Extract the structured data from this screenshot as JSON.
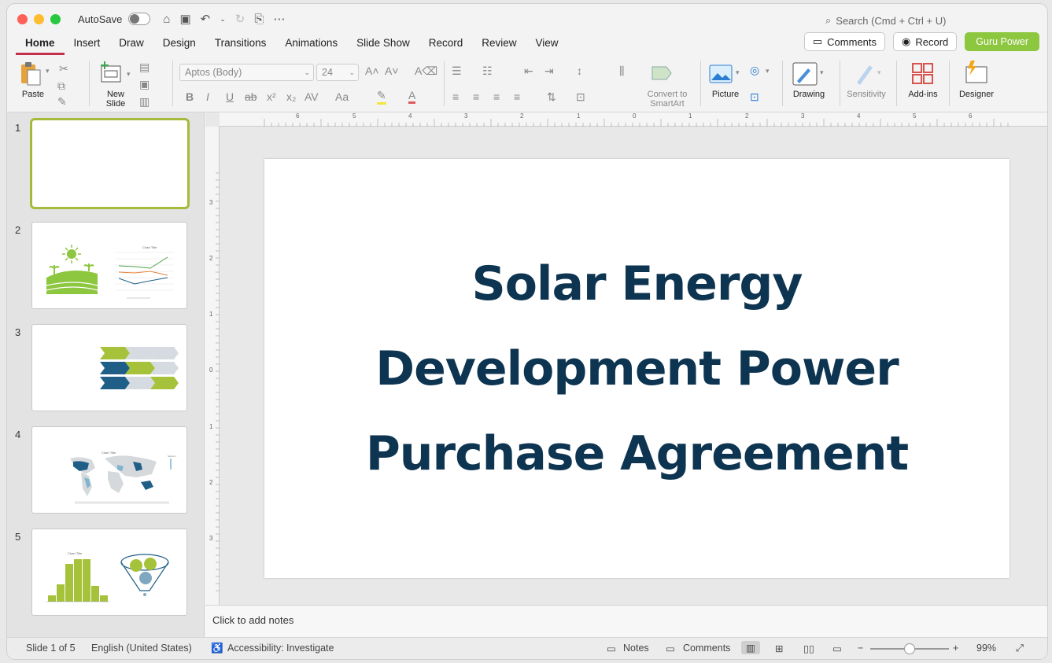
{
  "titlebar": {
    "autosave_label": "AutoSave",
    "search_placeholder": "Search (Cmd + Ctrl + U)"
  },
  "tabs": [
    "Home",
    "Insert",
    "Draw",
    "Design",
    "Transitions",
    "Animations",
    "Slide Show",
    "Record",
    "Review",
    "View"
  ],
  "active_tab": "Home",
  "top_buttons": {
    "comments": "Comments",
    "record": "Record",
    "guru": "Guru Power"
  },
  "ribbon": {
    "paste": "Paste",
    "new_slide": "New Slide",
    "font_name": "Aptos (Body)",
    "font_size": "24",
    "convert_smartart": "Convert to SmartArt",
    "picture": "Picture",
    "drawing": "Drawing",
    "sensitivity": "Sensitivity",
    "addins": "Add-ins",
    "designer": "Designer"
  },
  "slides": [
    {
      "number": "1"
    },
    {
      "number": "2"
    },
    {
      "number": "3"
    },
    {
      "number": "4"
    },
    {
      "number": "5"
    }
  ],
  "current_slide": {
    "title": "Solar Energy Development Power Purchase Agreement"
  },
  "ruler": {
    "h_labels": [
      "6",
      "5",
      "4",
      "3",
      "2",
      "1",
      "0",
      "1",
      "2",
      "3",
      "4",
      "5",
      "6"
    ],
    "v_labels": [
      "3",
      "2",
      "1",
      "0",
      "1",
      "2",
      "3"
    ]
  },
  "notes_placeholder": "Click to add notes",
  "status": {
    "slide_info": "Slide 1 of 5",
    "language": "English (United States)",
    "accessibility": "Accessibility: Investigate",
    "notes": "Notes",
    "comments": "Comments",
    "zoom": "99%",
    "zoom_value": 0.5
  },
  "colors": {
    "title_color": "#0d3450",
    "accent_green": "#8dc63f",
    "active_tab_underline": "#c4314b",
    "thumb_selected_border": "#a7b93a"
  }
}
